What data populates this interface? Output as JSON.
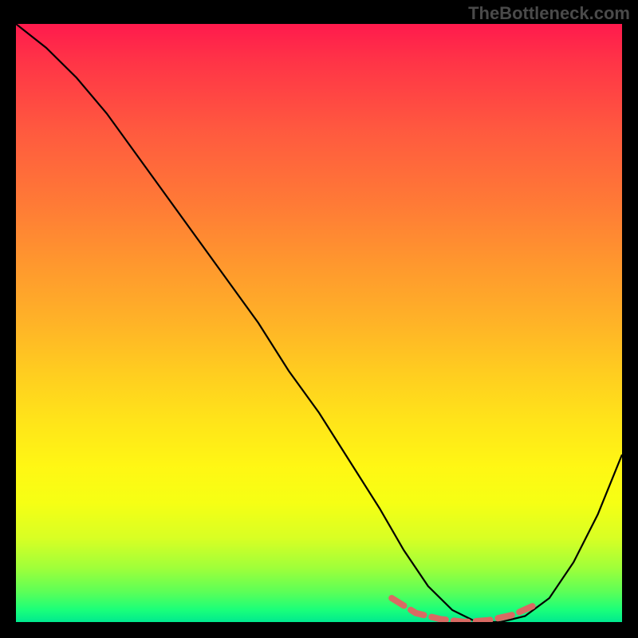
{
  "watermark": "TheBottleneck.com",
  "chart_data": {
    "type": "line",
    "title": "",
    "xlabel": "",
    "ylabel": "",
    "xlim": [
      0,
      100
    ],
    "ylim": [
      0,
      100
    ],
    "note": "Bottleneck-percentage style curve. Background gradient encodes the y-axis (red=high bottleneck, green=low). Black curve shows bottleneck % across a parameter; salmon segment marks the optimal (~0%) range.",
    "series": [
      {
        "name": "bottleneck-curve",
        "color": "#000000",
        "x": [
          0,
          5,
          10,
          15,
          20,
          25,
          30,
          35,
          40,
          45,
          50,
          55,
          60,
          64,
          68,
          72,
          76,
          80,
          84,
          88,
          92,
          96,
          100
        ],
        "values": [
          100,
          96,
          91,
          85,
          78,
          71,
          64,
          57,
          50,
          42,
          35,
          27,
          19,
          12,
          6,
          2,
          0,
          0,
          1,
          4,
          10,
          18,
          28
        ]
      },
      {
        "name": "optimal-range",
        "color": "#d96a63",
        "x": [
          62,
          66,
          70,
          74,
          78,
          82,
          86
        ],
        "values": [
          4,
          1.5,
          0.5,
          0,
          0.3,
          1.2,
          3
        ]
      }
    ],
    "gradient_stops": [
      {
        "pct": 0,
        "color": "#ff1a4d"
      },
      {
        "pct": 18,
        "color": "#ff5a3f"
      },
      {
        "pct": 40,
        "color": "#ff972e"
      },
      {
        "pct": 58,
        "color": "#ffcc20"
      },
      {
        "pct": 74,
        "color": "#fff714"
      },
      {
        "pct": 86,
        "color": "#d8ff24"
      },
      {
        "pct": 95,
        "color": "#5bff58"
      },
      {
        "pct": 100,
        "color": "#00e98f"
      }
    ]
  }
}
